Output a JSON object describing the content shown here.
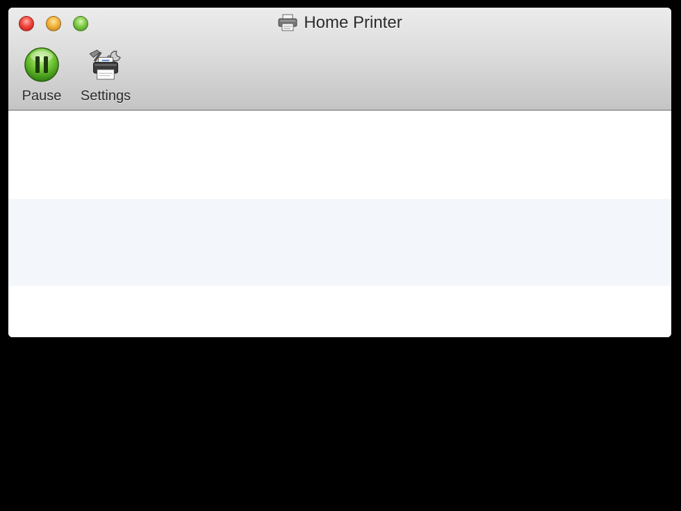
{
  "window": {
    "title": "Home Printer",
    "title_icon": "printer-icon"
  },
  "toolbar": {
    "pause_label": "Pause",
    "pause_icon": "pause-icon",
    "settings_label": "Settings",
    "settings_icon": "printer-settings-icon"
  },
  "colors": {
    "close": "#f2463c",
    "minimize": "#f2b43a",
    "zoom": "#7fcb45",
    "pause_button": "#6cc12f",
    "row_alt": "#f3f6fb",
    "background": "#000000"
  },
  "queue": {
    "rows": [
      "",
      "",
      ""
    ]
  }
}
